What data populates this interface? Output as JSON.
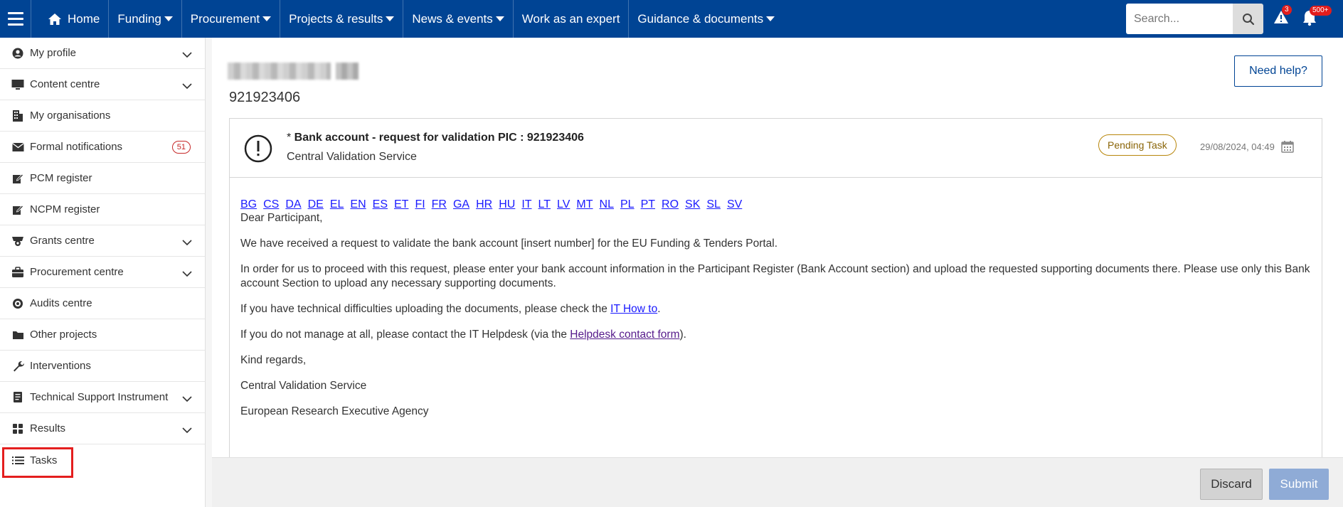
{
  "topnav": {
    "items": [
      {
        "label": "Home",
        "caret": false
      },
      {
        "label": "Funding",
        "caret": true
      },
      {
        "label": "Procurement",
        "caret": true
      },
      {
        "label": "Projects & results",
        "caret": true
      },
      {
        "label": "News & events",
        "caret": true
      },
      {
        "label": "Work as an expert",
        "caret": false
      },
      {
        "label": "Guidance & documents",
        "caret": true
      }
    ],
    "search_placeholder": "Search...",
    "alerts_count": "3",
    "notifications_count": "500+"
  },
  "sidebar": {
    "items": [
      {
        "label": "My profile",
        "icon": "user-circle-icon",
        "expandable": true
      },
      {
        "label": "Content centre",
        "icon": "monitor-icon",
        "expandable": true
      },
      {
        "label": "My organisations",
        "icon": "building-icon",
        "expandable": false
      },
      {
        "label": "Formal notifications",
        "icon": "envelope-icon",
        "expandable": false,
        "badge": "51"
      },
      {
        "label": "PCM register",
        "icon": "edit-icon",
        "expandable": false
      },
      {
        "label": "NCPM register",
        "icon": "edit-icon",
        "expandable": false
      },
      {
        "label": "Grants centre",
        "icon": "grants-icon",
        "expandable": true
      },
      {
        "label": "Procurement centre",
        "icon": "briefcase-icon",
        "expandable": true
      },
      {
        "label": "Audits centre",
        "icon": "target-icon",
        "expandable": false
      },
      {
        "label": "Other projects",
        "icon": "folder-icon",
        "expandable": false
      },
      {
        "label": "Interventions",
        "icon": "wrench-icon",
        "expandable": false
      },
      {
        "label": "Technical Support Instrument",
        "icon": "document-icon",
        "expandable": true
      },
      {
        "label": "Results",
        "icon": "grid-icon",
        "expandable": true
      },
      {
        "label": "Tasks",
        "icon": "list-icon",
        "expandable": false,
        "highlighted": true
      }
    ]
  },
  "page": {
    "pic": "921923406",
    "help_label": "Need help?"
  },
  "task": {
    "title_prefix": "* ",
    "title": "Bank account - request for validation PIC : 921923406",
    "subtitle": "Central Validation Service",
    "status": "Pending Task",
    "date": "29/08/2024, 04:49",
    "languages": [
      "BG",
      "CS",
      "DA",
      "DE",
      "EL",
      "EN",
      "ES",
      "ET",
      "FI",
      "FR",
      "GA",
      "HR",
      "HU",
      "IT",
      "LT",
      "LV",
      "MT",
      "NL",
      "PL",
      "PT",
      "RO",
      "SK",
      "SL",
      "SV"
    ],
    "greeting": "Dear Participant,",
    "para1": "We have received a request to validate the bank account [insert number] for the EU Funding & Tenders Portal.",
    "para2": "In order for us to proceed with this request, please enter your bank account information in the Participant Register (Bank Account section) and upload the requested supporting documents there. Please use only this Bank account Section to upload any necessary supporting documents.",
    "para3_before": "If you have technical difficulties uploading the documents, please check the ",
    "para3_link": "IT How to",
    "para3_after": ".",
    "para4_before": "If you do not manage at all, please contact the IT Helpdesk (via the ",
    "para4_link": "Helpdesk contact form",
    "para4_after": ").",
    "closing": "Kind regards,",
    "sign1": "Central Validation Service",
    "sign2": "European Research Executive Agency"
  },
  "footer": {
    "discard_label": "Discard",
    "submit_label": "Submit"
  }
}
